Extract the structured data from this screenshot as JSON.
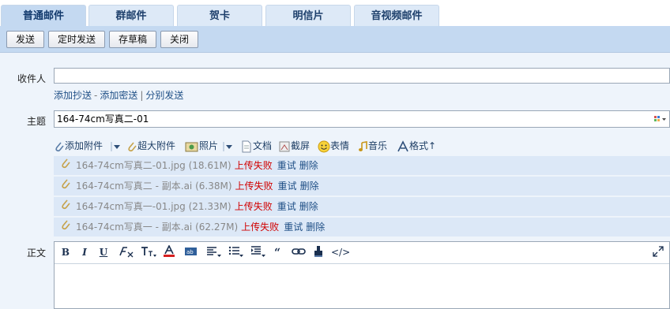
{
  "tabs": [
    {
      "label": "普通邮件",
      "active": true
    },
    {
      "label": "群邮件"
    },
    {
      "label": "贺卡"
    },
    {
      "label": "明信片"
    },
    {
      "label": "音视频邮件"
    }
  ],
  "toolbar": {
    "send": "发送",
    "scheduled_send": "定时发送",
    "save_draft": "存草稿",
    "close": "关闭"
  },
  "form": {
    "recipient_label": "收件人",
    "recipient_value": "",
    "add_cc": "添加抄送",
    "add_bcc": "添加密送",
    "separate_send": "分别发送",
    "subject_label": "主题",
    "subject_value": "164-74cm写真二-01",
    "body_label": "正文"
  },
  "attach_toolbar": {
    "add_attachment": "添加附件",
    "super_attachment": "超大附件",
    "photo": "照片",
    "document": "文档",
    "screenshot": "截屏",
    "emoticon": "表情",
    "music": "音乐",
    "format": "格式↑"
  },
  "attachments": [
    {
      "name": "164-74cm写真二-01.jpg",
      "size": "(18.61M)",
      "status": "上传失败",
      "retry": "重试",
      "delete": "删除"
    },
    {
      "name": "164-74cm写真二 - 副本.ai",
      "size": "(6.38M)",
      "status": "上传失败",
      "retry": "重试",
      "delete": "删除"
    },
    {
      "name": "164-74cm写真一-01.jpg",
      "size": "(21.33M)",
      "status": "上传失败",
      "retry": "重试",
      "delete": "删除"
    },
    {
      "name": "164-74cm写真一 - 副本.ai",
      "size": "(62.27M)",
      "status": "上传失败",
      "retry": "重试",
      "delete": "删除"
    }
  ],
  "editor": {
    "bold": "B",
    "italic": "I",
    "underline": "U",
    "source": "</>"
  },
  "colors": {
    "tab_bg": "#dde9f7",
    "toolbar_bg": "#c4d9f1",
    "panel_bg": "#eef4fb",
    "error": "#d10000",
    "link": "#1f4f86"
  }
}
